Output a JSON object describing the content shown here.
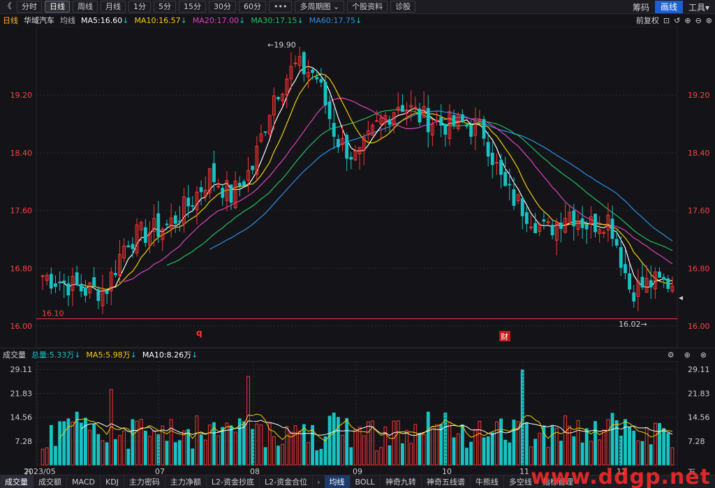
{
  "toolbar": {
    "back_glyph": "《",
    "buttons": [
      "分时",
      "日线",
      "周线",
      "月线",
      "1分",
      "5分",
      "15分",
      "30分",
      "60分",
      "•••",
      "多周期图 ⌄",
      "个股资料",
      "诊股"
    ],
    "active_index": 1,
    "right": [
      "筹码",
      "画线",
      "工具▾"
    ]
  },
  "header": {
    "period": "日线",
    "stock_name": "华域汽车",
    "avg_label": "均线",
    "ma5": "MA5:16.60",
    "ma10": "MA10:16.57",
    "ma20": "MA20:17.00",
    "ma30": "MA30:17.15",
    "ma60": "MA60:17.75",
    "adjust": "前复权"
  },
  "colors": {
    "up": "#ff3333",
    "down": "#19c3c3",
    "ma5": "#ffffff",
    "ma10": "#f5d000",
    "ma20": "#e040c0",
    "ma30": "#20c060",
    "ma60": "#2b8fe8",
    "axis_label": "#ff4040",
    "grid": "#2a2a32"
  },
  "price_axis": {
    "ticks": [
      "19.20",
      "18.40",
      "17.60",
      "16.80",
      "16.00"
    ],
    "tick_values": [
      19.2,
      18.4,
      17.6,
      16.8,
      16.0
    ],
    "range": [
      15.7,
      20.15
    ]
  },
  "annotations": {
    "high": "19.90",
    "low": "16.02",
    "left_label": "16.10",
    "marker_q": "q",
    "marker_cai": "财"
  },
  "volume": {
    "title": "成交量",
    "total": "总量:5.33万",
    "ma5": "MA5:5.98万",
    "ma10": "MA10:8.26万",
    "ticks": [
      "29.11",
      "21.83",
      "14.56",
      "7.28",
      "万"
    ],
    "tick_values": [
      29.11,
      21.83,
      14.56,
      7.28
    ]
  },
  "x_axis": [
    "2023/05",
    "07",
    "08",
    "09",
    "10",
    "11",
    "12"
  ],
  "tabs": [
    "成交量",
    "成交额",
    "MACD",
    "KDJ",
    "主力密码",
    "主力净额",
    "L2-资金抄底",
    "L2-资金合位",
    "›",
    "均线",
    "BOLL",
    "神奇九转",
    "神奇五线谱",
    "牛熊线",
    "多空线",
    "指标管理"
  ],
  "watermark": "www.ddgp.net",
  "chart_data": {
    "type": "candlestick",
    "title": "华域汽车",
    "xlabel": "",
    "ylabel": "",
    "ylim": [
      16.0,
      20.0
    ],
    "months": [
      "2023/05",
      "07",
      "08",
      "09",
      "10",
      "11",
      "12"
    ],
    "approx_closes": [
      16.7,
      16.6,
      16.5,
      16.5,
      17.2,
      17.3,
      17.4,
      17.7,
      18.1,
      17.8,
      18.2,
      19.2,
      19.6,
      19.5,
      18.6,
      18.3,
      18.8,
      19.1,
      18.9,
      18.8,
      18.8,
      18.7,
      17.9,
      17.6,
      17.3,
      17.6,
      17.4,
      17.5,
      16.5,
      16.6,
      16.6
    ],
    "key_levels": {
      "high": 19.9,
      "low": 16.02,
      "reference": 16.1
    }
  }
}
